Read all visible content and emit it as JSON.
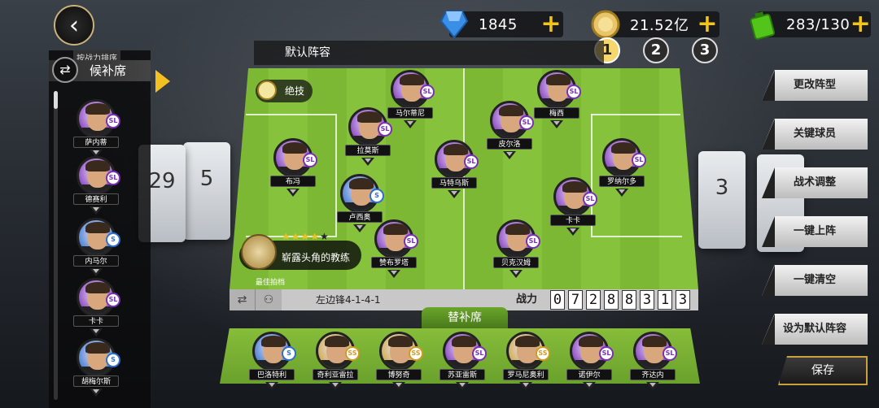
{
  "top": {
    "gems": "1845",
    "coins": "21.52亿",
    "energy": "283/130",
    "pages": [
      "1",
      "2",
      "3"
    ],
    "active_page": 0
  },
  "bench": {
    "sort_label": "按战力排序",
    "title": "候补席",
    "players": [
      {
        "name": "萨内蒂",
        "badge": "SL",
        "badge_color": "purple"
      },
      {
        "name": "德赛利",
        "badge": "SL",
        "badge_color": "purple"
      },
      {
        "name": "内马尔",
        "badge": "S",
        "badge_color": "blue"
      },
      {
        "name": "卡卡",
        "badge": "SL",
        "badge_color": "purple"
      },
      {
        "name": "胡梅尔斯",
        "badge": "S",
        "badge_color": "blue"
      }
    ]
  },
  "pitch": {
    "header": "默认阵容",
    "skill_label": "绝技",
    "coach": {
      "stars": "★★★★",
      "empty_star": "★",
      "name": "崭露头角的教练"
    },
    "best_label": "最佳拍档",
    "formation": "左边锋4-1-4-1",
    "power_label": "战力",
    "power_digits": [
      "0",
      "7",
      "2",
      "8",
      "8",
      "3",
      "1",
      "3"
    ],
    "players": [
      {
        "name": "马尔蒂尼",
        "badge": "SL",
        "badge_color": "purple"
      },
      {
        "name": "梅西",
        "badge": "SL",
        "badge_color": "purple"
      },
      {
        "name": "拉莫斯",
        "badge": "SL",
        "badge_color": "purple"
      },
      {
        "name": "皮尔洛",
        "badge": "SL",
        "badge_color": "purple"
      },
      {
        "name": "布冯",
        "badge": "SL",
        "badge_color": "purple"
      },
      {
        "name": "马特乌斯",
        "badge": "SL",
        "badge_color": "purple"
      },
      {
        "name": "罗纳尔多",
        "badge": "SL",
        "badge_color": "purple"
      },
      {
        "name": "卢西奥",
        "badge": "S",
        "badge_color": "blue"
      },
      {
        "name": "卡卡",
        "badge": "SL",
        "badge_color": "purple"
      },
      {
        "name": "赞布罗塔",
        "badge": "SL",
        "badge_color": "purple"
      },
      {
        "name": "贝克汉姆",
        "badge": "SL",
        "badge_color": "purple"
      }
    ]
  },
  "subs": {
    "tab_label": "替补席",
    "players": [
      {
        "name": "巴洛特利",
        "badge": "S",
        "badge_color": "blue"
      },
      {
        "name": "奇利亚雷拉",
        "badge": "SS",
        "badge_color": "gold"
      },
      {
        "name": "博努奇",
        "badge": "SS",
        "badge_color": "gold"
      },
      {
        "name": "苏亚雷斯",
        "badge": "SL",
        "badge_color": "purple"
      },
      {
        "name": "罗马尼奥利",
        "badge": "SS",
        "badge_color": "gold"
      },
      {
        "name": "诺伊尔",
        "badge": "SL",
        "badge_color": "purple"
      },
      {
        "name": "齐达内",
        "badge": "SL",
        "badge_color": "purple"
      }
    ]
  },
  "actions": {
    "change_formation": "更改阵型",
    "key_players": "关键球员",
    "tactics": "战术调整",
    "auto_lineup": "一键上阵",
    "clear_all": "一键清空",
    "set_default": "设为默认阵容",
    "save": "保存"
  }
}
